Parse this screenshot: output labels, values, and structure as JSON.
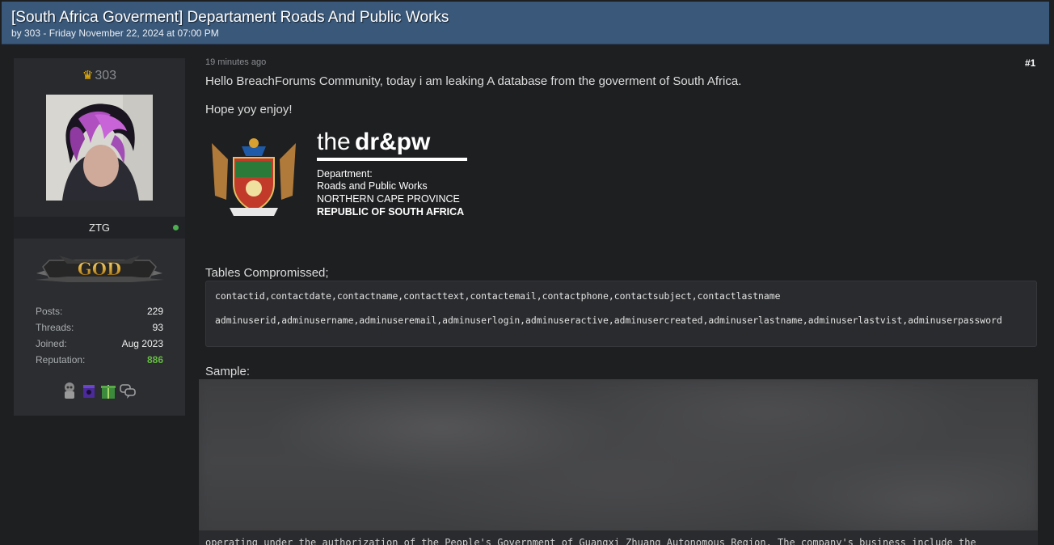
{
  "thread": {
    "title": "[South Africa Goverment] Departament Roads And Public Works",
    "meta": "by 303 - Friday November 22, 2024 at 07:00 PM"
  },
  "author": {
    "title_name": "303",
    "username": "ZTG",
    "online": true,
    "rank": "GOD",
    "stats": [
      {
        "label": "Posts:",
        "value": "229"
      },
      {
        "label": "Threads:",
        "value": "93"
      },
      {
        "label": "Joined:",
        "value": "Aug 2023"
      },
      {
        "label": "Reputation:",
        "value": "886"
      }
    ],
    "awards": [
      "robot-award-icon",
      "purple-box-award-icon",
      "green-gift-award-icon",
      "chat-bubbles-award-icon"
    ]
  },
  "post": {
    "time": "19 minutes ago",
    "number": "#1",
    "paragraph1": "Hello BreachForums Community, today i am leaking A database from the goverment of South Africa.",
    "paragraph2": "Hope yoy enjoy!",
    "logo": {
      "the": "the",
      "brand": "dr&pw",
      "line1": "Department:",
      "line2": "Roads and Public Works",
      "line3": "NORTHERN CAPE PROVINCE",
      "line4": "REPUBLIC OF SOUTH AFRICA"
    },
    "tables_heading": "Tables Compromissed;",
    "tables": [
      "contactid,contactdate,contactname,contacttext,contactemail,contactphone,contactsubject,contactlastname",
      "adminuserid,adminusername,adminuseremail,adminuserlogin,adminuseractive,adminusercreated,adminuserlastname,adminuserlastvist,adminuserpassword"
    ],
    "sample_heading": "Sample:",
    "sample_tail": "operating under the authorization of the People's Government of Guangxi Zhuang Autonomous Region. The company's business include the"
  },
  "colors": {
    "header_bg": "#3a5879",
    "page_bg": "#1e1f21",
    "reputation": "#66bb44",
    "online": "#4caf50",
    "crown": "#f2b705"
  }
}
